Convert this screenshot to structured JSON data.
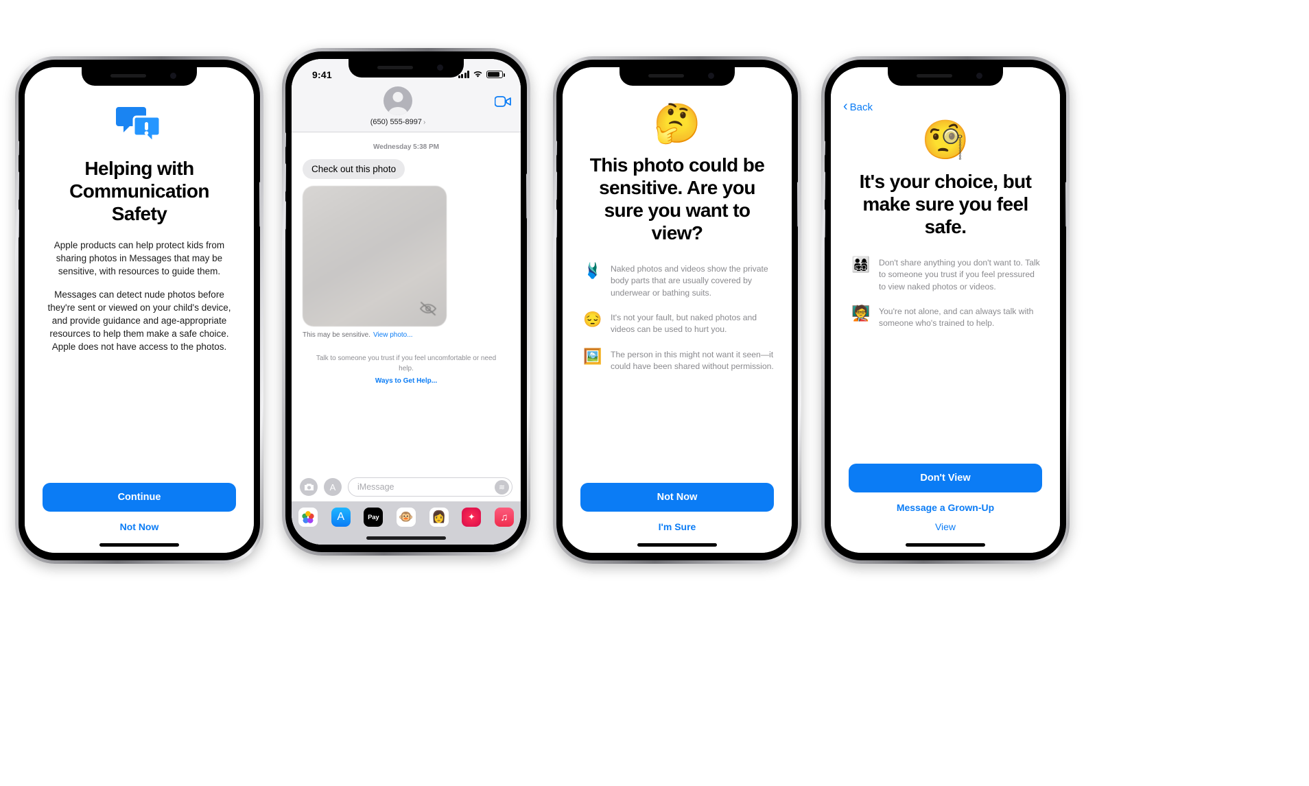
{
  "status_bar": {
    "time": "9:41"
  },
  "phone1": {
    "icon": "message-alert-icon",
    "title": "Helping with Communication Safety",
    "paragraphs": [
      "Apple products can help protect kids from sharing photos in Messages that may be sensitive, with resources to guide them.",
      "Messages can detect nude photos before they're sent or viewed on your child's device, and provide guidance and age-appropriate resources to help them make a safe choice. Apple does not have access to the photos."
    ],
    "primary_button": "Continue",
    "secondary_button": "Not Now"
  },
  "phone2": {
    "back_icon": "chevron-left-icon",
    "contact": "(650) 555-8997",
    "contact_chevron": "›",
    "video_icon": "facetime-video-icon",
    "timestamp": "Wednesday 5:38 PM",
    "incoming_message": "Check out this photo",
    "sensitive_notice": "This may be sensitive.",
    "view_photo_link": "View photo...",
    "guidance_text": "Talk to someone you trust if you feel uncomfortable or need help.",
    "guidance_link": "Ways to Get Help...",
    "input_placeholder": "iMessage",
    "camera_icon": "camera-icon",
    "apps_icon": "app-store-icon",
    "mic_icon": "audio-waveform-icon",
    "drawer_apps": [
      {
        "name": "photos-app-icon",
        "glyph": ""
      },
      {
        "name": "app-store-app-icon",
        "glyph": "A"
      },
      {
        "name": "apple-pay-app-icon",
        "glyph": "Pay"
      },
      {
        "name": "memoji-app-icon",
        "glyph": "🐵"
      },
      {
        "name": "memoji-people-app-icon",
        "glyph": "👩"
      },
      {
        "name": "fitness-app-icon",
        "glyph": "✦"
      },
      {
        "name": "music-app-icon",
        "glyph": "♫"
      }
    ]
  },
  "phone3": {
    "emoji": "🤔",
    "title": "This photo could be sensitive. Are you sure you want to view?",
    "bullets": [
      {
        "icon": "🩱",
        "icon_name": "swimsuit-icon",
        "text": "Naked photos and videos show the private body parts that are usually covered by underwear or bathing suits."
      },
      {
        "icon": "😔",
        "icon_name": "sad-face-icon",
        "text": "It's not your fault, but naked photos and videos can be used to hurt you."
      },
      {
        "icon": "🖼️",
        "icon_name": "framed-picture-icon",
        "text": "The person in this might not want it seen—it could have been shared without permission."
      }
    ],
    "primary_button": "Not Now",
    "secondary_button": "I'm Sure"
  },
  "phone4": {
    "back_label": "Back",
    "back_icon": "chevron-left-icon",
    "emoji": "🧐",
    "title": "It's your choice, but make sure you feel safe.",
    "bullets": [
      {
        "icon": "👨‍👩‍👧‍👦",
        "icon_name": "family-icon",
        "text": "Don't share anything you don't want to. Talk to someone you trust if you feel pressured to view naked photos or videos."
      },
      {
        "icon": "🧑‍🏫",
        "icon_name": "teacher-icon",
        "text": "You're not alone, and can always talk with someone who's trained to help."
      }
    ],
    "primary_button": "Don't View",
    "secondary_button": "Message a Grown-Up",
    "tertiary_button": "View"
  },
  "colors": {
    "accent": "#0b7cf5",
    "muted_text": "#8a8a8e",
    "bubble_bg": "#e9e9eb"
  }
}
